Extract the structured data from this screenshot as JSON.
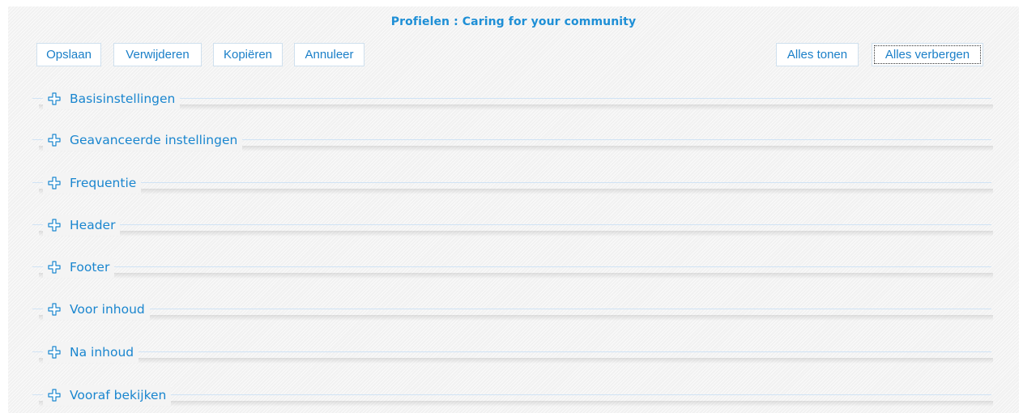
{
  "header": {
    "title": "Profielen : Caring for your community"
  },
  "toolbar": {
    "save_label": "Opslaan",
    "delete_label": "Verwijderen",
    "copy_label": "Kopiëren",
    "cancel_label": "Annuleer",
    "show_all_label": "Alles tonen",
    "hide_all_label": "Alles verbergen"
  },
  "sections": [
    {
      "label": "Basisinstellingen",
      "icon": "plus-icon",
      "expanded": false
    },
    {
      "label": "Geavanceerde instellingen",
      "icon": "plus-icon",
      "expanded": false
    },
    {
      "label": "Frequentie",
      "icon": "plus-icon",
      "expanded": false
    },
    {
      "label": "Header",
      "icon": "plus-icon",
      "expanded": false
    },
    {
      "label": "Footer",
      "icon": "plus-icon",
      "expanded": false
    },
    {
      "label": "Voor inhoud",
      "icon": "plus-icon",
      "expanded": false
    },
    {
      "label": "Na inhoud",
      "icon": "plus-icon",
      "expanded": false
    },
    {
      "label": "Vooraf bekijken",
      "icon": "plus-icon",
      "expanded": false
    }
  ],
  "colors": {
    "accent": "#1a86cf",
    "title": "#1e8fd6",
    "rule": "#d0e3f5",
    "background": "#f4f4f4"
  }
}
